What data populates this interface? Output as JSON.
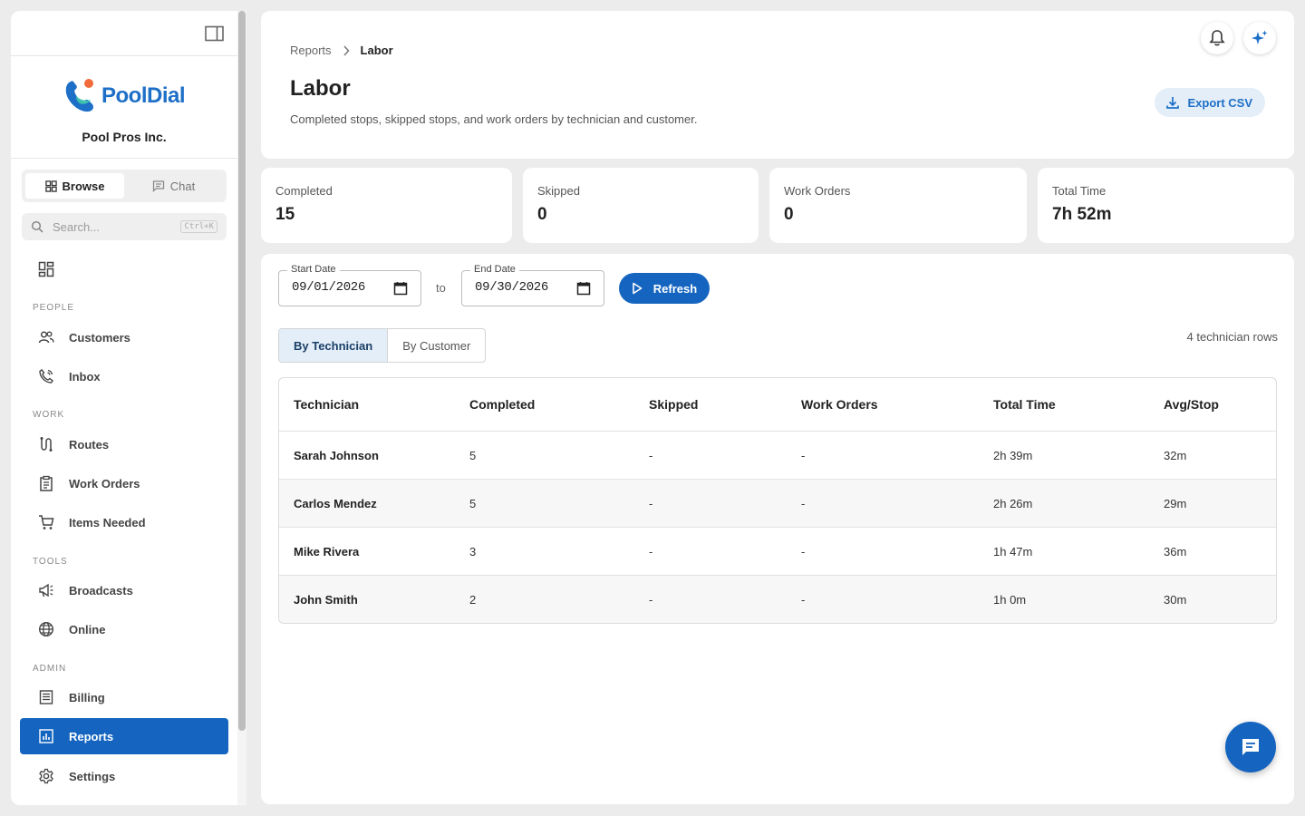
{
  "sidebar": {
    "org_name": "Pool Pros Inc.",
    "logo_text": "PoolDial",
    "segments": {
      "browse": "Browse",
      "chat": "Chat"
    },
    "search": {
      "placeholder": "Search...",
      "shortcut": "Ctrl+K"
    },
    "dashboard": "Dashboard",
    "sections": {
      "people": "PEOPLE",
      "work": "WORK",
      "tools": "TOOLS",
      "admin": "ADMIN"
    },
    "items": {
      "customers": "Customers",
      "inbox": "Inbox",
      "routes": "Routes",
      "work_orders": "Work Orders",
      "items_needed": "Items Needed",
      "broadcasts": "Broadcasts",
      "online": "Online",
      "billing": "Billing",
      "reports": "Reports",
      "settings": "Settings"
    },
    "active_item": "Reports"
  },
  "header": {
    "breadcrumb": {
      "root": "Reports",
      "current": "Labor"
    },
    "title": "Labor",
    "subtitle": "Completed stops, skipped stops, and work orders by technician and customer.",
    "export_label": "Export CSV"
  },
  "stats": [
    {
      "label": "Completed",
      "value": "15"
    },
    {
      "label": "Skipped",
      "value": "0"
    },
    {
      "label": "Work Orders",
      "value": "0"
    },
    {
      "label": "Total Time",
      "value": "7h 52m"
    }
  ],
  "filters": {
    "start_label": "Start Date",
    "start_value": "09/01/2026",
    "to_text": "to",
    "end_label": "End Date",
    "end_value": "09/30/2026",
    "refresh_label": "Refresh"
  },
  "tabs": {
    "by_technician": "By Technician",
    "by_customer": "By Customer",
    "active": "By Technician"
  },
  "row_count": "4 technician rows",
  "table": {
    "columns": [
      "Technician",
      "Completed",
      "Skipped",
      "Work Orders",
      "Total Time",
      "Avg/Stop"
    ],
    "rows": [
      [
        "Sarah Johnson",
        "5",
        "-",
        "-",
        "2h 39m",
        "32m"
      ],
      [
        "Carlos Mendez",
        "5",
        "-",
        "-",
        "2h 26m",
        "29m"
      ],
      [
        "Mike Rivera",
        "3",
        "-",
        "-",
        "1h 47m",
        "36m"
      ],
      [
        "John Smith",
        "2",
        "-",
        "-",
        "1h 0m",
        "30m"
      ]
    ]
  },
  "colors": {
    "primary": "#1565c0",
    "accent_light": "#e4eef8",
    "logo_orange": "#f26b3a",
    "logo_teal": "#3fc1b0"
  },
  "icons": {
    "panel_toggle": "panel-toggle-icon",
    "notifications": "bell-icon",
    "assistant": "sparkles-icon",
    "export": "download-icon",
    "refresh": "play-icon",
    "chat_fab": "chat-bubble-icon"
  }
}
